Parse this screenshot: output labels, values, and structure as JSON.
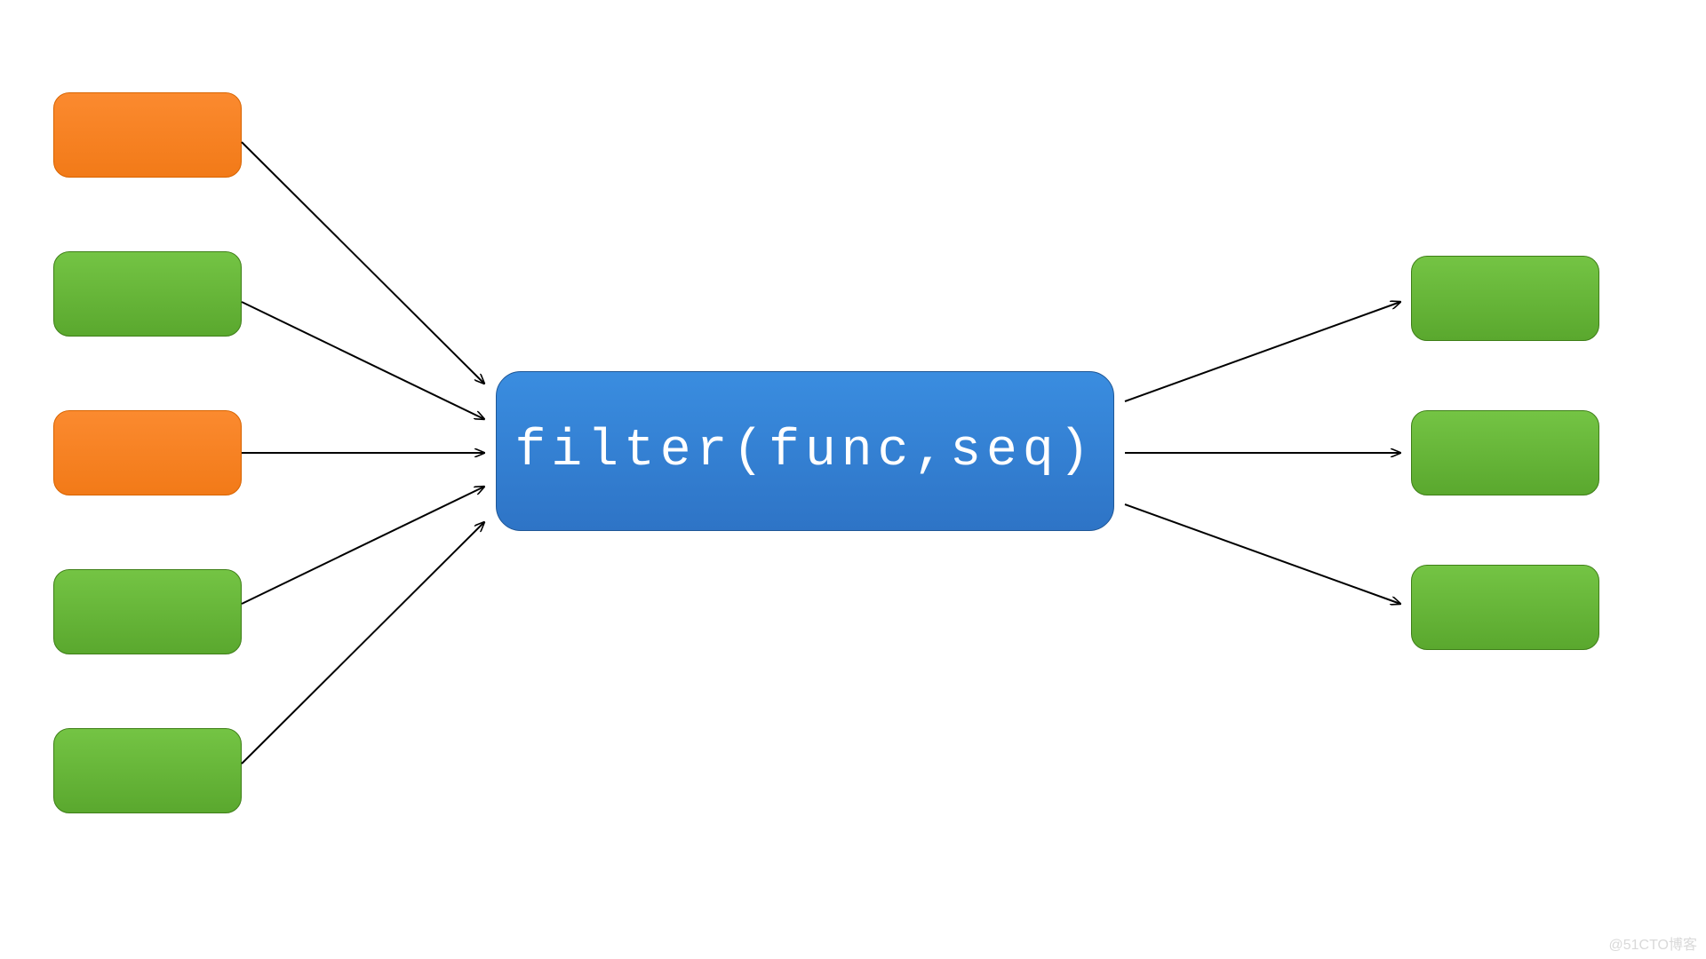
{
  "filter": {
    "label": "filter(func,seq)"
  },
  "watermark": "@51CTO博客",
  "chart_data": {
    "type": "diagram",
    "description": "Filter function diagram: five input boxes (orange = rejected, green = passes) flow into a central filter(func,seq) node; three green boxes output on the right.",
    "inputs": [
      {
        "index": 1,
        "color": "orange",
        "passes": false
      },
      {
        "index": 2,
        "color": "green",
        "passes": true
      },
      {
        "index": 3,
        "color": "orange",
        "passes": false
      },
      {
        "index": 4,
        "color": "green",
        "passes": true
      },
      {
        "index": 5,
        "color": "green",
        "passes": true
      }
    ],
    "center_node": "filter(func,seq)",
    "outputs": [
      {
        "index": 1,
        "color": "green"
      },
      {
        "index": 2,
        "color": "green"
      },
      {
        "index": 3,
        "color": "green"
      }
    ],
    "colors": {
      "orange": "#f27a18",
      "green": "#5aa82e",
      "blue": "#2e74c6"
    }
  }
}
